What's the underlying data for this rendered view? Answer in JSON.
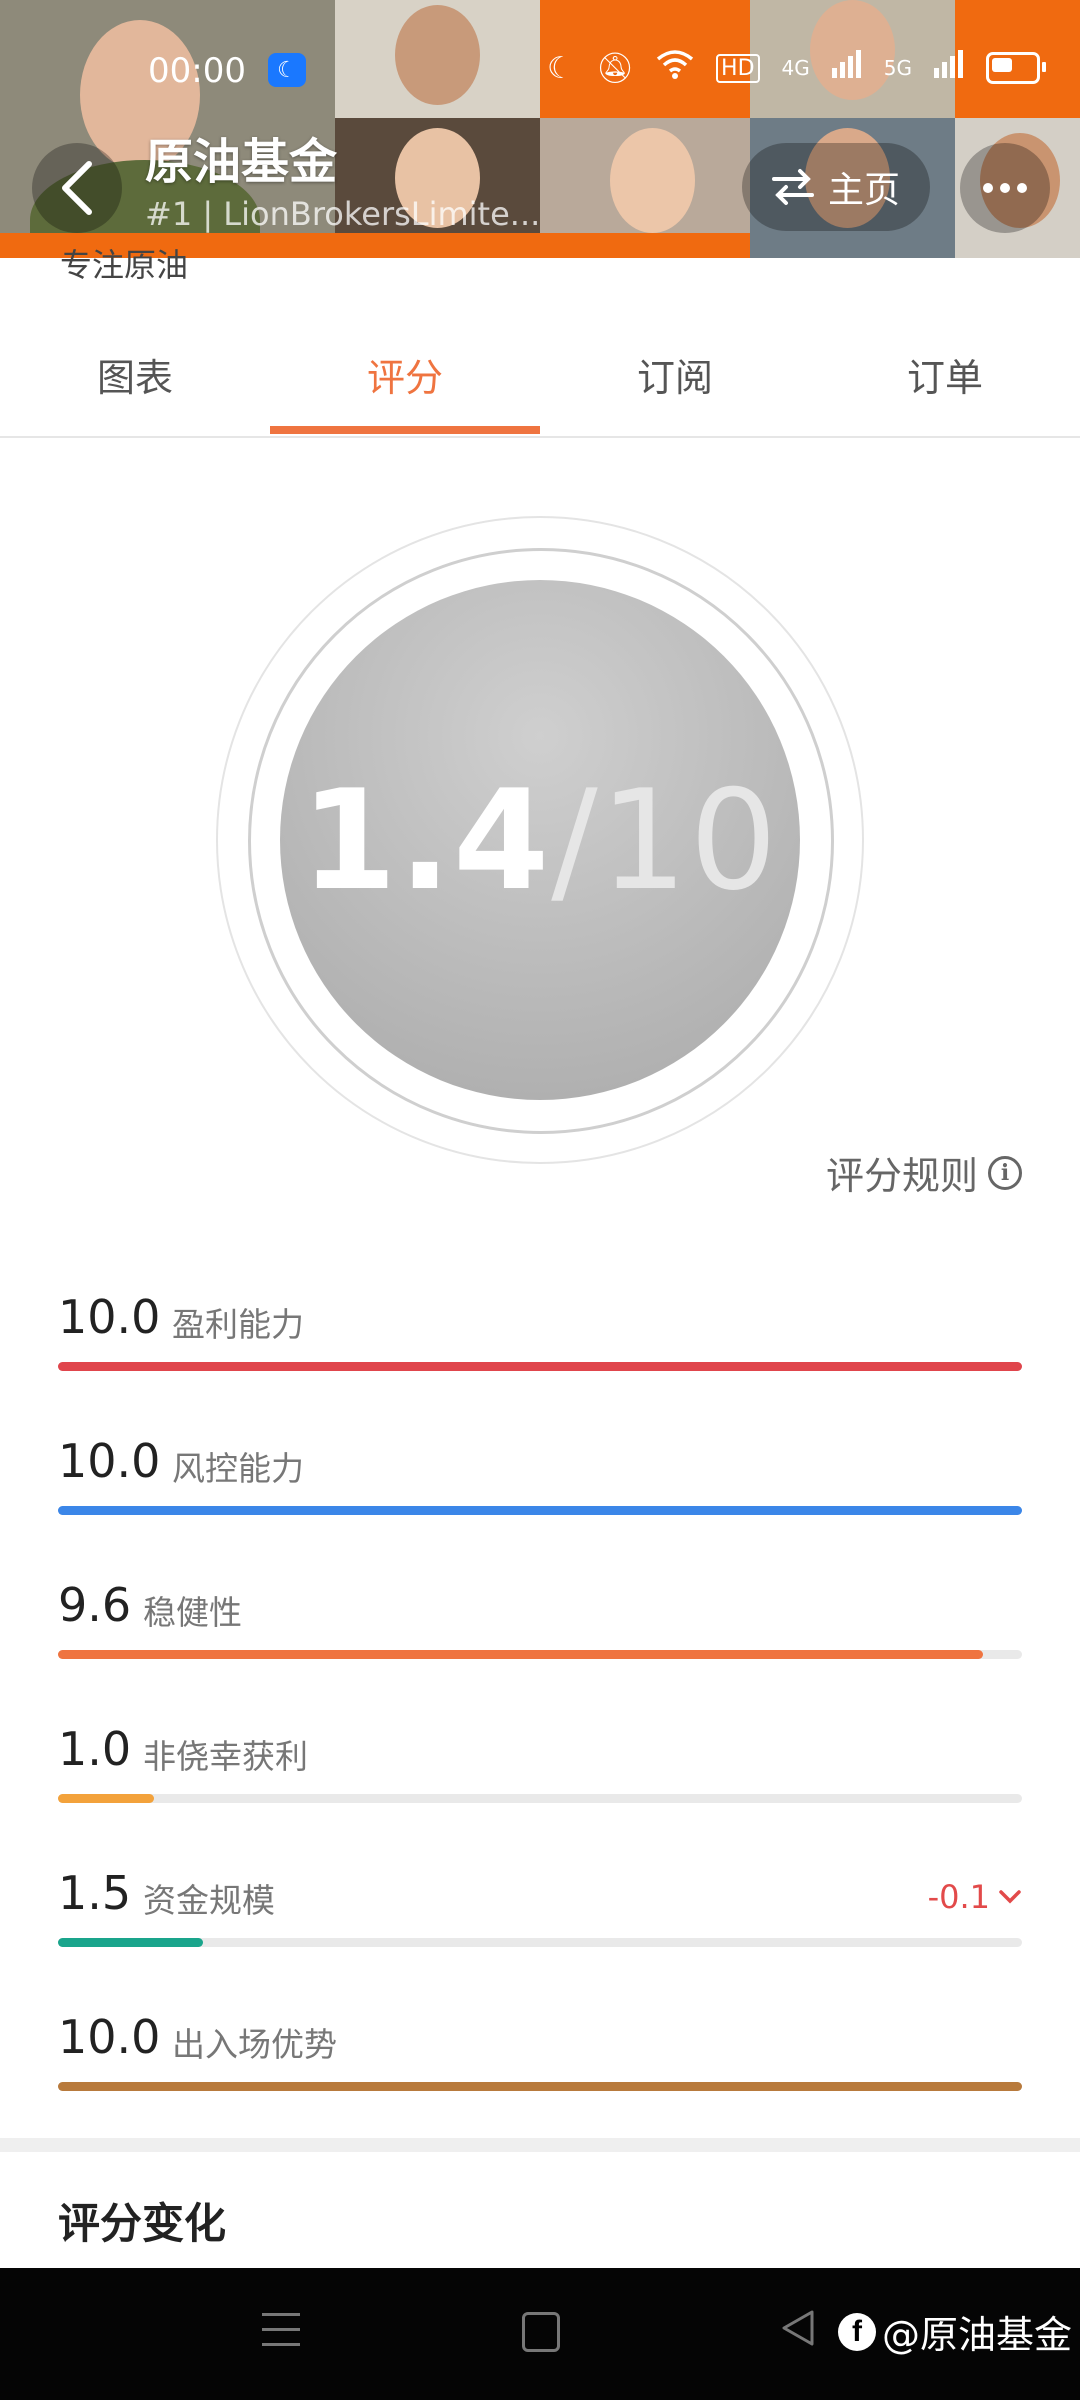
{
  "status_bar": {
    "time": "00:00",
    "net1": "HD",
    "net2": "4G",
    "net3": "5G",
    "icons": [
      "moon-icon",
      "bell-muted-icon",
      "wifi-icon",
      "signal-icon",
      "battery-icon"
    ]
  },
  "header": {
    "title": "原油基金",
    "subtitle": "#1 | LionBrokersLimite...",
    "home_label": "主页",
    "tagline": "专注原油"
  },
  "tabs": [
    {
      "label": "图表",
      "active": false
    },
    {
      "label": "评分",
      "active": true
    },
    {
      "label": "订阅",
      "active": false
    },
    {
      "label": "订单",
      "active": false
    }
  ],
  "score": {
    "value": "1.4",
    "max": "/10"
  },
  "rules_label": "评分规则",
  "metrics": [
    {
      "value": "10.0",
      "label": "盈利能力",
      "fraction": 1.0,
      "color": "#e0454c",
      "delta": ""
    },
    {
      "value": "10.0",
      "label": "风控能力",
      "fraction": 1.0,
      "color": "#3b86e8",
      "delta": ""
    },
    {
      "value": "9.6",
      "label": "稳健性",
      "fraction": 0.96,
      "color": "#ef7440",
      "delta": ""
    },
    {
      "value": "1.0",
      "label": "非侥幸获利",
      "fraction": 0.1,
      "color": "#f3a23b",
      "delta": ""
    },
    {
      "value": "1.5",
      "label": "资金规模",
      "fraction": 0.15,
      "color": "#1aa58c",
      "delta": "-0.1"
    },
    {
      "value": "10.0",
      "label": "出入场优势",
      "fraction": 1.0,
      "color": "#b87a3c",
      "delta": ""
    }
  ],
  "section_title": "评分变化",
  "watermark": "@原油基金",
  "accent_color": "#ef7440"
}
